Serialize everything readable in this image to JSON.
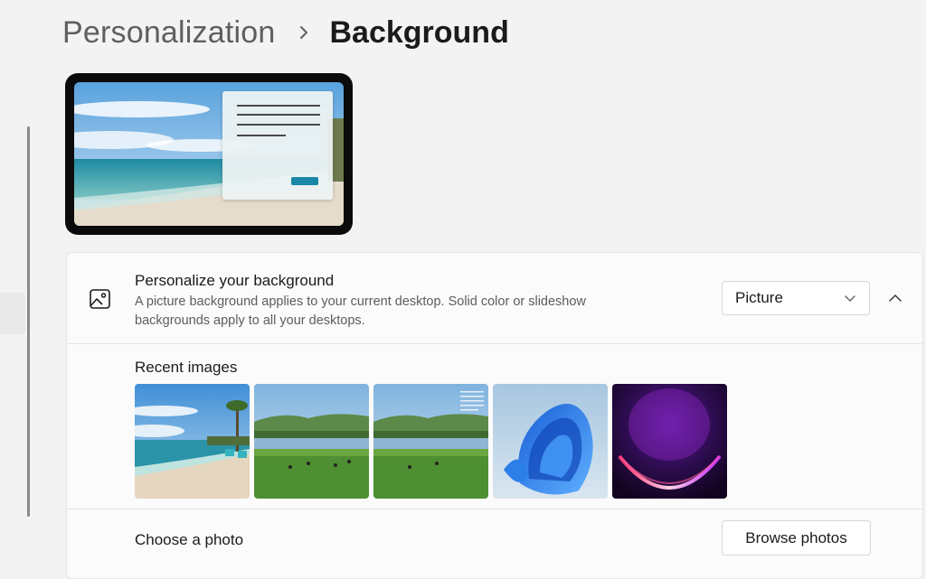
{
  "breadcrumb": {
    "parent": "Personalization",
    "separator_icon": "chevron-right-icon",
    "current": "Background"
  },
  "preview": {
    "description_icon": "desktop-preview"
  },
  "personalize": {
    "icon": "picture-icon",
    "title": "Personalize your background",
    "description": "A picture background applies to your current desktop. Solid color or slideshow backgrounds apply to all your desktops.",
    "dropdown": {
      "selected": "Picture",
      "icon": "chevron-down-icon"
    },
    "collapse_icon": "chevron-up-icon"
  },
  "recent_images": {
    "label": "Recent images",
    "items": [
      "beach",
      "green-valley-lake",
      "green-valley-lake-overlay",
      "windows-bloom",
      "purple-glow"
    ]
  },
  "choose_photo": {
    "label": "Choose a photo",
    "button": "Browse photos"
  },
  "colors": {
    "page_bg": "#f3f3f3",
    "card_bg": "#fbfbfb",
    "accent": "#1a87a6"
  }
}
